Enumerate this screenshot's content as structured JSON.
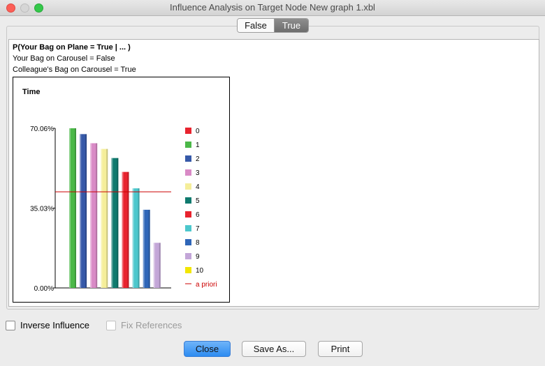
{
  "window": {
    "title": "Influence Analysis on Target Node New graph 1.xbl"
  },
  "tabs": [
    {
      "label": "False",
      "selected": false
    },
    {
      "label": "True",
      "selected": true
    }
  ],
  "query": {
    "target": "P(Your Bag on Plane = True | ... )",
    "evidence": [
      "Your Bag on Carousel = False",
      "Colleague's Bag on Carousel = True"
    ]
  },
  "chart_data": {
    "type": "bar",
    "title": "Time",
    "categories": [
      "0",
      "1",
      "2",
      "3",
      "4",
      "5",
      "6",
      "7",
      "8",
      "9",
      "10"
    ],
    "values": [
      0,
      70.06,
      67.5,
      63.5,
      61.0,
      57.0,
      50.9,
      43.7,
      34.3,
      19.8,
      0
    ],
    "colors": [
      "#e8232e",
      "#4bb848",
      "#3659a8",
      "#d98ac6",
      "#f5ee9a",
      "#0f7a6e",
      "#e8232e",
      "#4cc7cc",
      "#2f66b8",
      "#c3a6d8",
      "#f2e600"
    ],
    "ytick_labels": [
      "0.00%",
      "35.03%",
      "70.06%"
    ],
    "ylim": [
      0,
      70.06
    ],
    "reference_line": {
      "label": "a priori",
      "value": 42.2,
      "color": "#cc0000"
    },
    "legend_position": "right"
  },
  "options": {
    "inverse_influence": {
      "label": "Inverse Influence",
      "checked": false,
      "enabled": true
    },
    "fix_references": {
      "label": "Fix References",
      "checked": false,
      "enabled": false
    }
  },
  "buttons": {
    "close": "Close",
    "save_as": "Save As...",
    "print": "Print"
  }
}
